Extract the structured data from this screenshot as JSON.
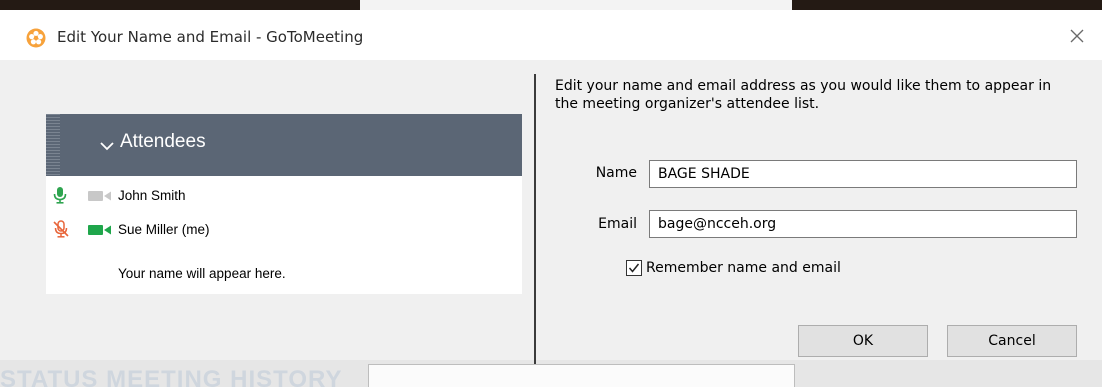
{
  "window": {
    "title": "Edit Your Name and Email - GoToMeeting",
    "icon": "gotomeeting-flower-icon",
    "close_icon": "close-icon"
  },
  "background": {
    "ghost_text": "STATUS     MEETING HISTORY"
  },
  "preview": {
    "header_label": "Attendees",
    "attendees": [
      {
        "name": "John Smith",
        "mic": "on",
        "camera": "off"
      },
      {
        "name": "Sue Miller (me)",
        "mic": "muted",
        "camera": "on"
      }
    ],
    "placeholder": "Your name will appear here."
  },
  "form": {
    "instructions": "Edit your name and email address as you would like them to appear in the meeting organizer's attendee list.",
    "name_label": "Name",
    "name_value": "BAGE SHADE",
    "email_label": "Email",
    "email_value": "bage@ncceh.org",
    "remember_label": "Remember name and email",
    "remember_checked": true
  },
  "buttons": {
    "ok": "OK",
    "cancel": "Cancel"
  },
  "colors": {
    "header_bg": "#5b6675",
    "mic_on": "#2ea44f",
    "mic_muted": "#e8653a",
    "camera_on": "#1fa64b",
    "camera_off": "#c8c8c8"
  }
}
